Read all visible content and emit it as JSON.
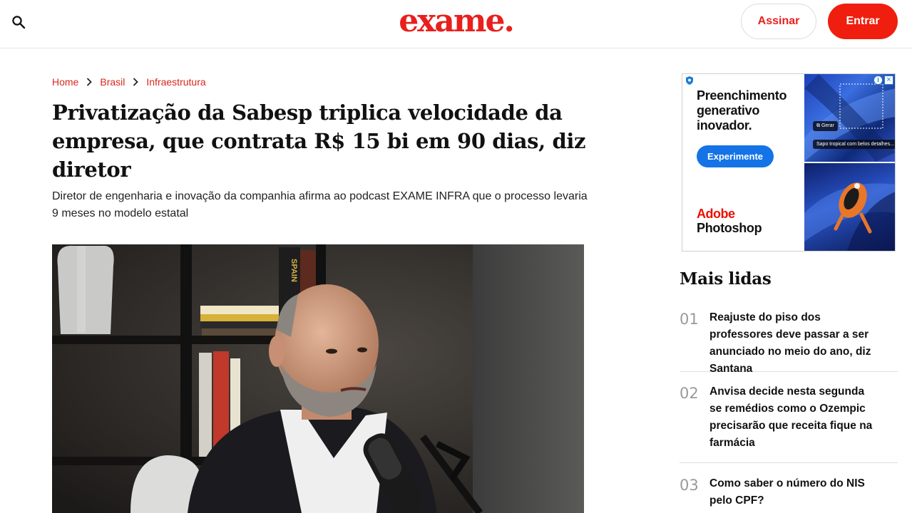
{
  "header": {
    "logo": "exame.",
    "search_icon": "search-icon",
    "subscribe_label": "Assinar",
    "login_label": "Entrar",
    "brand_color": "#e8201d"
  },
  "breadcrumb": {
    "items": [
      "Home",
      "Brasil",
      "Infraestrutura"
    ],
    "separator_icon": "chevron-right-icon"
  },
  "article": {
    "headline": "Privatização da Sabesp triplica velocidade da empresa, que contrata R$ 15 bi em 90 dias, diz diretor",
    "subtitle": "Diretor de engenharia e inovação da companhia afirma ao podcast EXAME INFRA que o processo levaria 9 meses no modelo estatal",
    "hero_image": {
      "spine_text": "SPAIN"
    }
  },
  "ad": {
    "headline": "Preenchimento generativo inovador.",
    "cta_label": "Experimente",
    "brand_line1": "Adobe",
    "brand_line2": "Photoshop",
    "chip_generate": "Gerar",
    "chip_prompt": "Sapo tropical com belos detalhes...",
    "close_icon": "close-icon",
    "info_icon": "info-icon",
    "adchoices_icon": "adchoices-icon",
    "cta_color": "#1473e6"
  },
  "most_read": {
    "title": "Mais lidas",
    "items": [
      {
        "num": "01",
        "title": "Reajuste do piso dos professores deve passar a ser anunciado no meio do ano, diz Santana"
      },
      {
        "num": "02",
        "title": "Anvisa decide nesta segunda se remédios como o Ozempic precisarão que receita fique na farmácia"
      },
      {
        "num": "03",
        "title": "Como saber o número do NIS pelo CPF?"
      }
    ]
  }
}
